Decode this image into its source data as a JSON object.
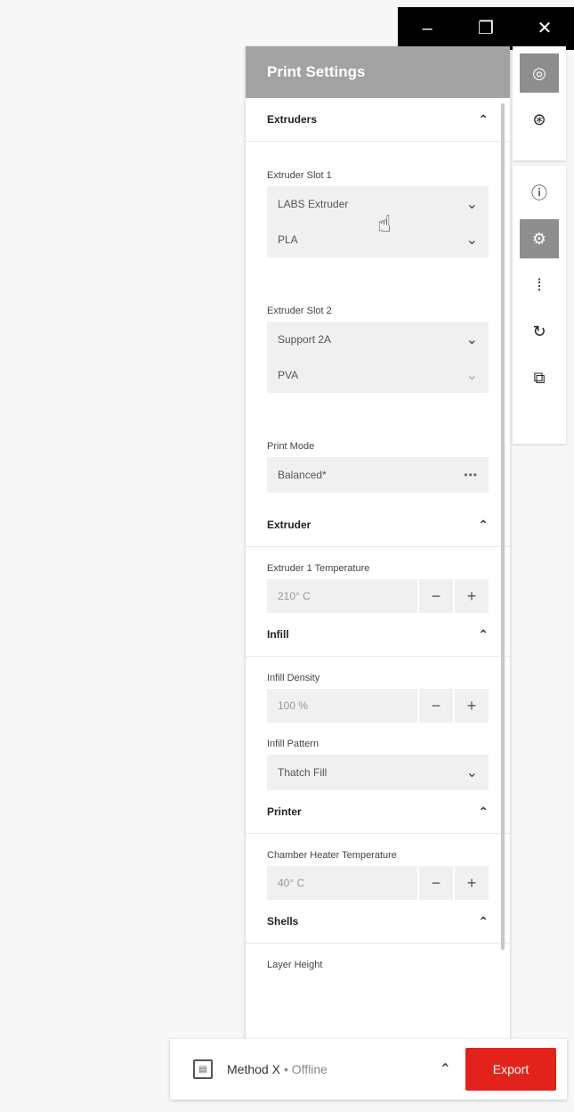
{
  "window": {
    "minimize": "–",
    "restore": "❐",
    "close": "✕"
  },
  "panel": {
    "title": "Print Settings"
  },
  "sections": {
    "extruders": {
      "title": "Extruders",
      "slot1": {
        "label": "Extruder Slot 1",
        "extruder": "LABS Extruder",
        "material": "PLA"
      },
      "slot2": {
        "label": "Extruder Slot 2",
        "extruder": "Support 2A",
        "material": "PVA"
      },
      "print_mode": {
        "label": "Print Mode",
        "value": "Balanced*",
        "more": "•••"
      }
    },
    "extruder": {
      "title": "Extruder",
      "temp_label": "Extruder 1 Temperature",
      "temp_value": "210° C",
      "minus": "−",
      "plus": "+"
    },
    "infill": {
      "title": "Infill",
      "density_label": "Infill Density",
      "density_value": "100 %",
      "pattern_label": "Infill Pattern",
      "pattern_value": "Thatch Fill",
      "minus": "−",
      "plus": "+"
    },
    "printer": {
      "title": "Printer",
      "chamber_label": "Chamber Heater Temperature",
      "chamber_value": "40° C",
      "minus": "−",
      "plus": "+"
    },
    "shells": {
      "title": "Shells",
      "layer_height_label": "Layer Height"
    }
  },
  "bottom": {
    "printer": "Method X",
    "status": "• Offline",
    "export": "Export"
  },
  "colors": {
    "accent": "#e3221c",
    "header": "#a3a3a3",
    "active_tool": "#8e8e8e"
  }
}
